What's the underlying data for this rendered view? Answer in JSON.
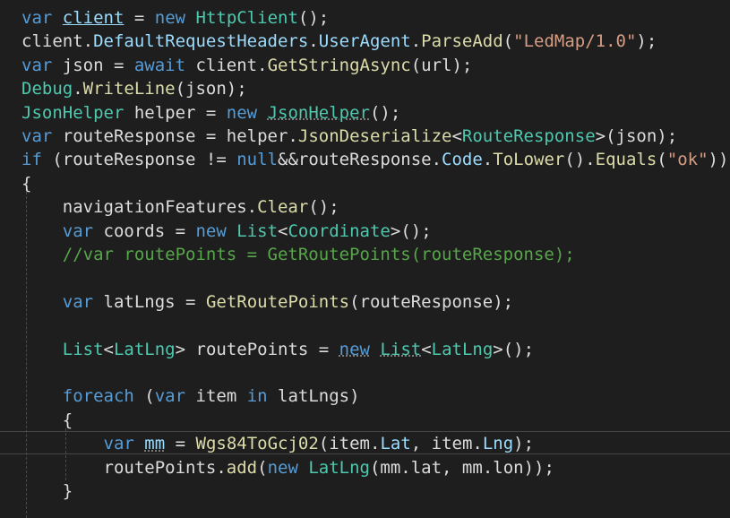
{
  "editor": {
    "lines": [
      [
        {
          "t": "var",
          "c": "kw"
        },
        {
          "t": " "
        },
        {
          "t": "client",
          "c": "va",
          "u": "solid"
        },
        {
          "t": " = "
        },
        {
          "t": "new",
          "c": "kw"
        },
        {
          "t": " "
        },
        {
          "t": "HttpClient",
          "c": "ty"
        },
        {
          "t": "();"
        }
      ],
      [
        {
          "t": "client."
        },
        {
          "t": "DefaultRequestHeaders",
          "c": "va"
        },
        {
          "t": "."
        },
        {
          "t": "UserAgent",
          "c": "va"
        },
        {
          "t": "."
        },
        {
          "t": "ParseAdd",
          "c": "me"
        },
        {
          "t": "("
        },
        {
          "t": "\"LedMap/1.0\"",
          "c": "st"
        },
        {
          "t": ");"
        }
      ],
      [
        {
          "t": "var",
          "c": "kw"
        },
        {
          "t": " json = "
        },
        {
          "t": "await",
          "c": "kw"
        },
        {
          "t": " client."
        },
        {
          "t": "GetStringAsync",
          "c": "me"
        },
        {
          "t": "(url);"
        }
      ],
      [
        {
          "t": "Debug",
          "c": "ty"
        },
        {
          "t": "."
        },
        {
          "t": "WriteLine",
          "c": "me"
        },
        {
          "t": "(json);"
        }
      ],
      [
        {
          "t": "JsonHelper",
          "c": "ty"
        },
        {
          "t": " helper = "
        },
        {
          "t": "new",
          "c": "kw"
        },
        {
          "t": " "
        },
        {
          "t": "JsonHelper",
          "c": "ty",
          "u": "dot"
        },
        {
          "t": "();"
        }
      ],
      [
        {
          "t": "var",
          "c": "kw"
        },
        {
          "t": " routeResponse = helper."
        },
        {
          "t": "JsonDeserialize",
          "c": "me"
        },
        {
          "t": "<"
        },
        {
          "t": "RouteResponse",
          "c": "ty"
        },
        {
          "t": ">(json);"
        }
      ],
      [
        {
          "t": "if",
          "c": "kw"
        },
        {
          "t": " (routeResponse != "
        },
        {
          "t": "null",
          "c": "kw"
        },
        {
          "t": "&&routeResponse."
        },
        {
          "t": "Code",
          "c": "va"
        },
        {
          "t": "."
        },
        {
          "t": "ToLower",
          "c": "me"
        },
        {
          "t": "()."
        },
        {
          "t": "Equals",
          "c": "me"
        },
        {
          "t": "("
        },
        {
          "t": "\"ok\"",
          "c": "st"
        },
        {
          "t": "))"
        }
      ],
      [
        {
          "t": "{"
        }
      ],
      [
        {
          "t": "    navigationFeatures."
        },
        {
          "t": "Clear",
          "c": "me"
        },
        {
          "t": "();"
        }
      ],
      [
        {
          "t": "    "
        },
        {
          "t": "var",
          "c": "kw"
        },
        {
          "t": " coords = "
        },
        {
          "t": "new",
          "c": "kw"
        },
        {
          "t": " "
        },
        {
          "t": "List",
          "c": "ty"
        },
        {
          "t": "<"
        },
        {
          "t": "Coordinate",
          "c": "ty"
        },
        {
          "t": ">();"
        }
      ],
      [
        {
          "t": "    "
        },
        {
          "t": "//var routePoints = GetRoutePoints(routeResponse);",
          "c": "cm"
        }
      ],
      [],
      [
        {
          "t": "    "
        },
        {
          "t": "var",
          "c": "kw"
        },
        {
          "t": " latLngs = "
        },
        {
          "t": "GetRoutePoints",
          "c": "me"
        },
        {
          "t": "(routeResponse);"
        }
      ],
      [],
      [
        {
          "t": "    "
        },
        {
          "t": "List",
          "c": "ty"
        },
        {
          "t": "<"
        },
        {
          "t": "LatLng",
          "c": "ty"
        },
        {
          "t": "> routePoints = "
        },
        {
          "t": "new",
          "c": "kw",
          "u": "dot"
        },
        {
          "t": " "
        },
        {
          "t": "List",
          "c": "ty",
          "u": "dot"
        },
        {
          "t": "<"
        },
        {
          "t": "LatLng",
          "c": "ty"
        },
        {
          "t": ">();"
        }
      ],
      [],
      [
        {
          "t": "    "
        },
        {
          "t": "foreach",
          "c": "kw"
        },
        {
          "t": " ("
        },
        {
          "t": "var",
          "c": "kw"
        },
        {
          "t": " item "
        },
        {
          "t": "in",
          "c": "kw"
        },
        {
          "t": " latLngs)"
        }
      ],
      [
        {
          "t": "    {"
        }
      ],
      [
        {
          "t": "        "
        },
        {
          "t": "var",
          "c": "kw"
        },
        {
          "t": " "
        },
        {
          "t": "mm",
          "c": "va",
          "u": "dot"
        },
        {
          "t": " = "
        },
        {
          "t": "Wgs84ToGcj02",
          "c": "me"
        },
        {
          "t": "(item."
        },
        {
          "t": "Lat",
          "c": "va"
        },
        {
          "t": ", item."
        },
        {
          "t": "Lng",
          "c": "va"
        },
        {
          "t": ");"
        }
      ],
      [
        {
          "t": "        routePoints."
        },
        {
          "t": "add",
          "c": "me"
        },
        {
          "t": "("
        },
        {
          "t": "new",
          "c": "kw"
        },
        {
          "t": " "
        },
        {
          "t": "LatLng",
          "c": "ty"
        },
        {
          "t": "(mm.lat, mm.lon));"
        }
      ],
      [
        {
          "t": "    }"
        }
      ]
    ]
  }
}
